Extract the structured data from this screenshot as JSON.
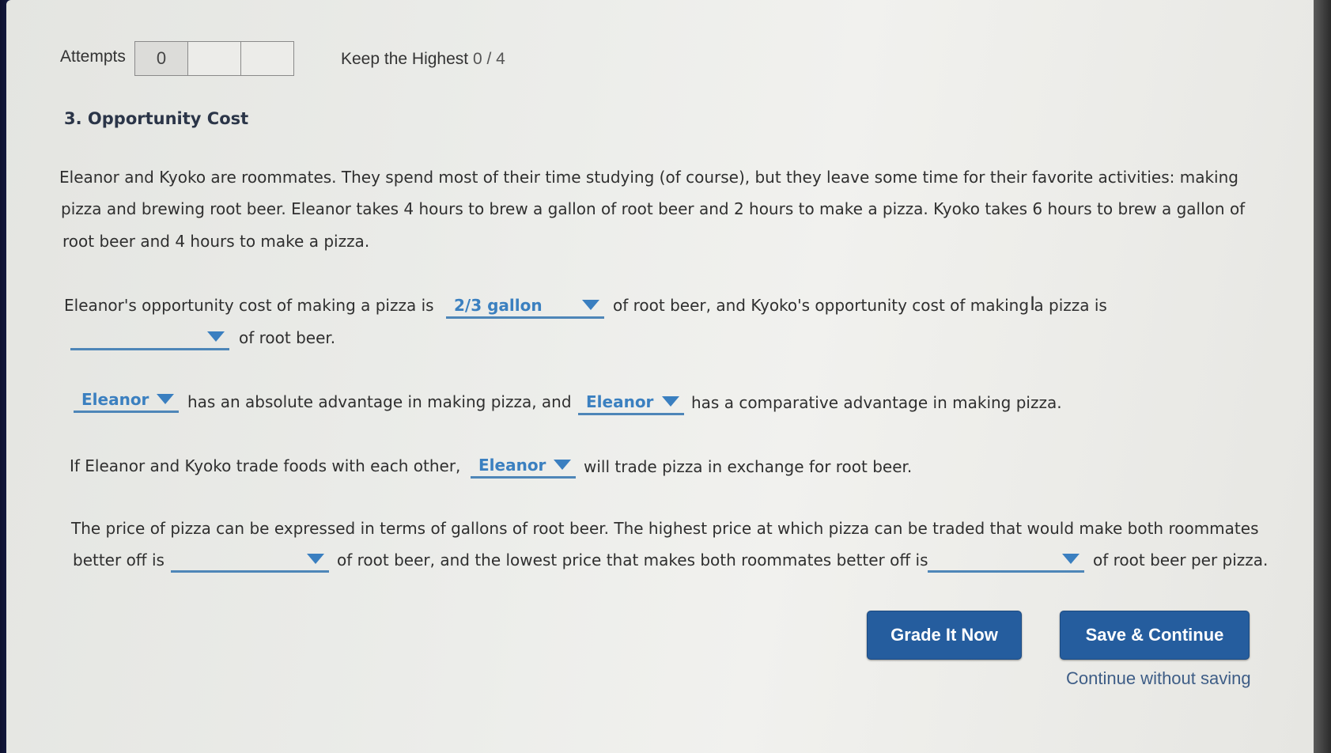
{
  "header": {
    "attempts_label": "Attempts",
    "attempt_boxes": [
      "0",
      "",
      ""
    ],
    "keep_label": "Keep the Highest",
    "keep_score": "0 / 4"
  },
  "question": {
    "title": "3. Opportunity Cost",
    "intro_lines": [
      "Eleanor and Kyoko are roommates. They spend most of their time studying (of course), but they leave some time for their favorite activities: making",
      "pizza and brewing root beer. Eleanor takes 4 hours to brew a gallon of root beer and 2 hours to make a pizza. Kyoko takes 6 hours to brew a gallon of",
      "root beer and 4 hours to make a pizza."
    ],
    "q1": {
      "text_a": "Eleanor's opportunity cost of making a pizza is",
      "dropdown_a": "2/3 gallon",
      "text_b": "of root beer, and Kyoko's opportunity cost of making a pizza is",
      "dropdown_b": "",
      "text_c": "of root beer."
    },
    "q2": {
      "dropdown_a": "Eleanor",
      "text_a": "has an absolute advantage in making pizza, and",
      "dropdown_b": "Eleanor",
      "text_b": "has a comparative advantage in making pizza."
    },
    "q3": {
      "text_a": "If Eleanor and Kyoko trade foods with each other,",
      "dropdown_a": "Eleanor",
      "text_b": "will trade pizza in exchange for root beer."
    },
    "q4": {
      "line1": "The price of pizza can be expressed in terms of gallons of root beer. The highest price at which pizza can be traded that would make both roommates",
      "text_a": "better off is",
      "dropdown_a": "",
      "text_b": "of root beer, and the lowest price that makes both roommates better off is",
      "dropdown_b": "",
      "text_c": "of root beer per pizza."
    }
  },
  "actions": {
    "grade_label": "Grade It Now",
    "save_label": "Save & Continue",
    "continue_link": "Continue without saving"
  },
  "colors": {
    "accent": "#3b80c0",
    "button": "#255d9e"
  }
}
